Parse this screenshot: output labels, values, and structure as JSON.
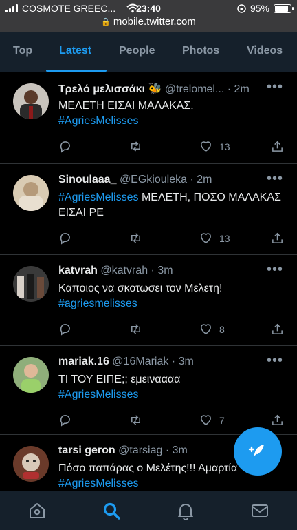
{
  "status": {
    "carrier": "COSMOTE GREEC...",
    "time": "23:40",
    "battery": "95%",
    "battery_level": 0.95,
    "url": "mobile.twitter.com",
    "lock_glyph": "🔒"
  },
  "tabs": [
    {
      "label": "Top"
    },
    {
      "label": "Latest"
    },
    {
      "label": "People"
    },
    {
      "label": "Photos"
    },
    {
      "label": "Videos"
    }
  ],
  "active_tab": "Latest",
  "tweets": [
    {
      "name": "Τρελό μελισσάκι 🐝",
      "handle": "@trelomel...",
      "dot": "·",
      "time": "2m",
      "text": "ΜΕΛΕΤΗ ΕΙΣΑΙ ΜΑΛΑΚΑΣ.",
      "hashtag": "#AgriesMelisses",
      "likes": "13"
    },
    {
      "name": "Sinoulaaa_",
      "handle": "@EGkiouleka",
      "dot": "·",
      "time": "2m",
      "hashtag": "#AgriesMelisses",
      "text": "ΜΕΛΕΤΗ, ΠΟΣΟ ΜΑΛΑΚΑΣ ΕΙΣΑΙ ΡΕ",
      "likes": "13"
    },
    {
      "name": "katvrah",
      "handle": "@katvrah",
      "dot": "·",
      "time": "3m",
      "text": "Καποιος να σκοτωσει τον Μελετη!",
      "hashtag": "#agriesmelisses",
      "likes": "8"
    },
    {
      "name": "mariak.16",
      "handle": "@16Mariak",
      "dot": "·",
      "time": "3m",
      "text": "ΤΙ ΤΟΥ ΕΙΠΕ;; εμειναααα",
      "hashtag": "#AgriesMelisses",
      "likes": "7"
    },
    {
      "name": "tarsi geron",
      "handle": "@tarsiag",
      "dot": "·",
      "time": "3m",
      "text": "Πόσο παπάρας ο Μελέτης!!! Αμαρτία",
      "hashtag": "#AgriesMelisses",
      "likes": ""
    }
  ],
  "more_glyph": "•••",
  "colors": {
    "accent": "#1d9bf0",
    "background": "#000000",
    "bar": "#15202b",
    "muted": "#8b98a5"
  },
  "icons": {
    "reply": "reply-icon",
    "retweet": "retweet-icon",
    "like": "heart-icon",
    "share": "share-icon",
    "compose": "compose-feather-icon",
    "home": "home-icon",
    "search": "search-icon",
    "notifications": "bell-icon",
    "messages": "mail-icon"
  }
}
